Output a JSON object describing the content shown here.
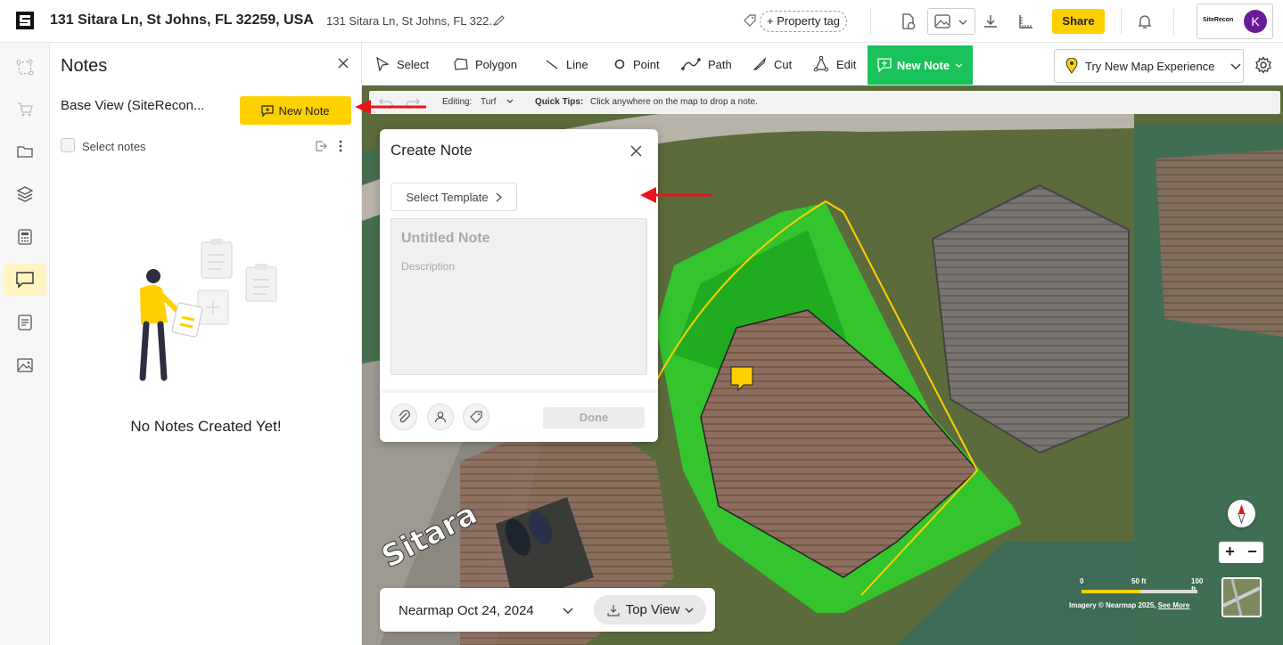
{
  "header": {
    "address": "131 Sitara Ln, St Johns, FL 32259, USA",
    "address_short": "131 Sitara Ln, St Johns, FL 322...",
    "property_tag_label": "+ Property tag",
    "share_label": "Share",
    "account_logo_text": "SiteRecon",
    "avatar_initial": "K"
  },
  "sidebar": {
    "items": [
      {
        "icon": "measure-icon"
      },
      {
        "icon": "cart-icon"
      },
      {
        "icon": "folder-icon"
      },
      {
        "icon": "layers-icon"
      },
      {
        "icon": "calculator-icon"
      },
      {
        "icon": "notes-icon",
        "active": true
      },
      {
        "icon": "document-icon"
      },
      {
        "icon": "image-icon"
      }
    ]
  },
  "notes_panel": {
    "title": "Notes",
    "view_name": "Base View (SiteRecon...",
    "new_note_label": "New Note",
    "select_notes_label": "Select notes",
    "empty_message": "No Notes Created Yet!"
  },
  "toolbar": {
    "tools": {
      "select": "Select",
      "polygon": "Polygon",
      "line": "Line",
      "point": "Point",
      "path": "Path",
      "cut": "Cut",
      "edit": "Edit"
    },
    "new_note_label": "New Note",
    "try_map_label": "Try New Map Experience"
  },
  "edit_bar": {
    "editing_label": "Editing:",
    "editing_value": "Turf",
    "tips_label": "Quick Tips:",
    "tips_text": "Click anywhere on the map to drop a note."
  },
  "create_note": {
    "title": "Create Note",
    "template_label": "Select Template",
    "title_placeholder": "Untitled Note",
    "description_placeholder": "Description",
    "done_label": "Done"
  },
  "map_footer": {
    "imagery_date": "Nearmap Oct 24, 2024",
    "view_mode": "Top View",
    "scale_labels": [
      "0",
      "50 ft",
      "100 ft"
    ],
    "credit_text": "Imagery © Nearmap 2025,",
    "credit_link": "See More",
    "street_label": "Sitara"
  },
  "colors": {
    "accent_yellow": "#ffd000",
    "new_note_green": "#19c25a",
    "avatar_purple": "#6a1b9a",
    "turf_green": "#2bd42b",
    "annotation_red": "#e8141a"
  }
}
